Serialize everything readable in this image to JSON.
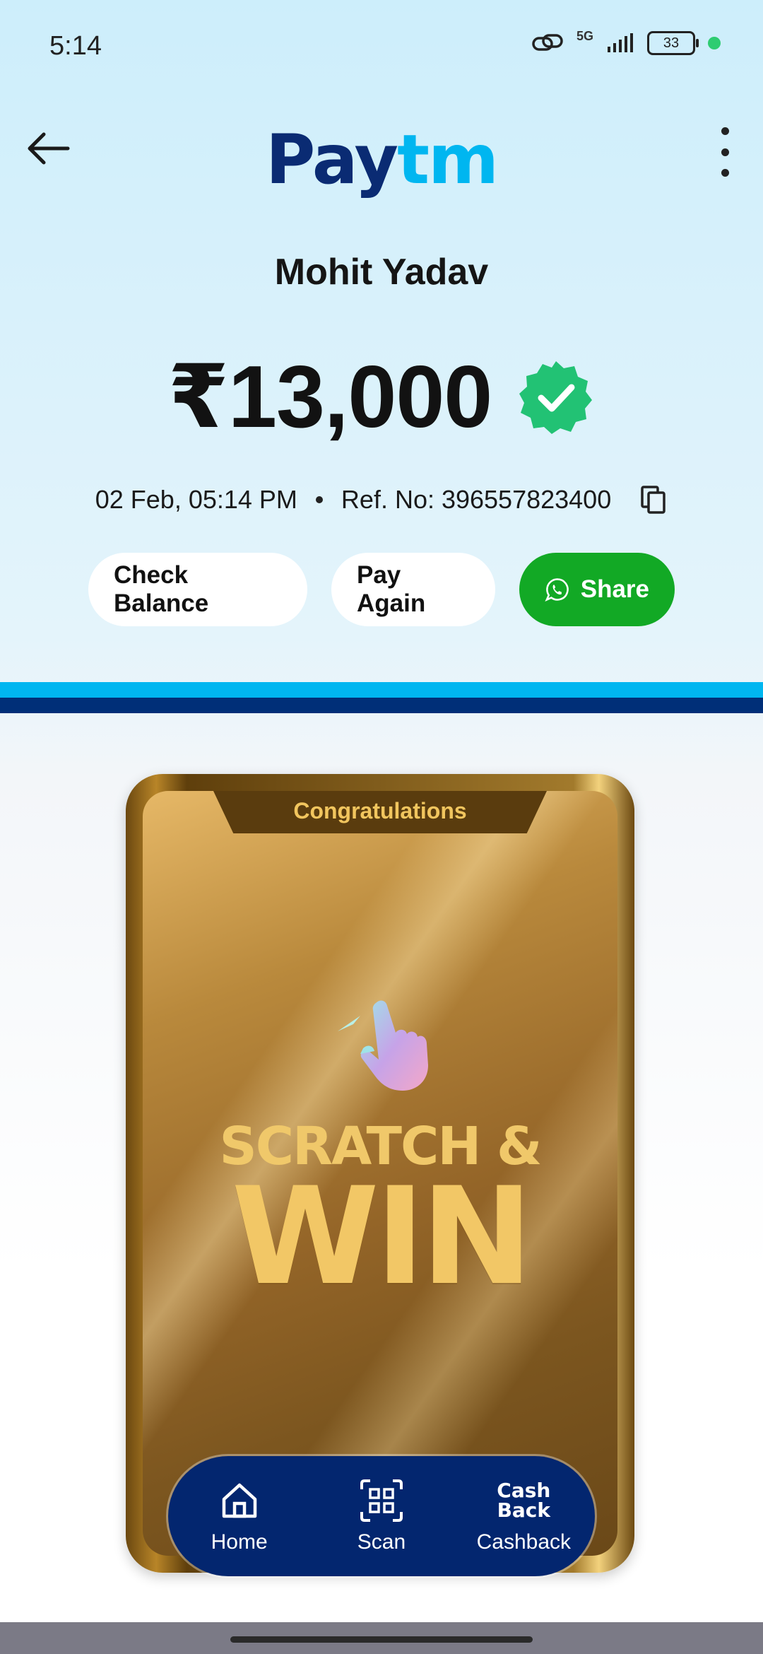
{
  "status_bar": {
    "time": "5:14",
    "network": "5G",
    "battery": "33"
  },
  "header": {
    "logo_pay": "Pay",
    "logo_tm": "tm"
  },
  "transaction": {
    "payee_name": "Mohit Yadav",
    "amount": "₹13,000",
    "datetime": "02 Feb, 05:14 PM",
    "ref_no": "Ref. No: 396557823400"
  },
  "actions": {
    "check_balance": "Check Balance",
    "pay_again": "Pay Again",
    "share": "Share"
  },
  "scratch_card": {
    "header": "Congratulations",
    "title_line1": "SCRATCH &",
    "title_line2": "WIN"
  },
  "bottom_nav": {
    "items": [
      {
        "label": "Home",
        "icon": "home-icon"
      },
      {
        "label": "Scan",
        "icon": "scan-icon"
      },
      {
        "label": "Cashback",
        "icon": "cashback-icon"
      }
    ],
    "cashback_glyph_top": "Cash",
    "cashback_glyph_bottom": "Back"
  },
  "colors": {
    "brand_dark": "#0a2b73",
    "brand_light": "#00b6f0",
    "share_green": "#12a925",
    "verified_green": "#22c274",
    "nav_bg": "#03266f",
    "gold": "#f2c766"
  }
}
